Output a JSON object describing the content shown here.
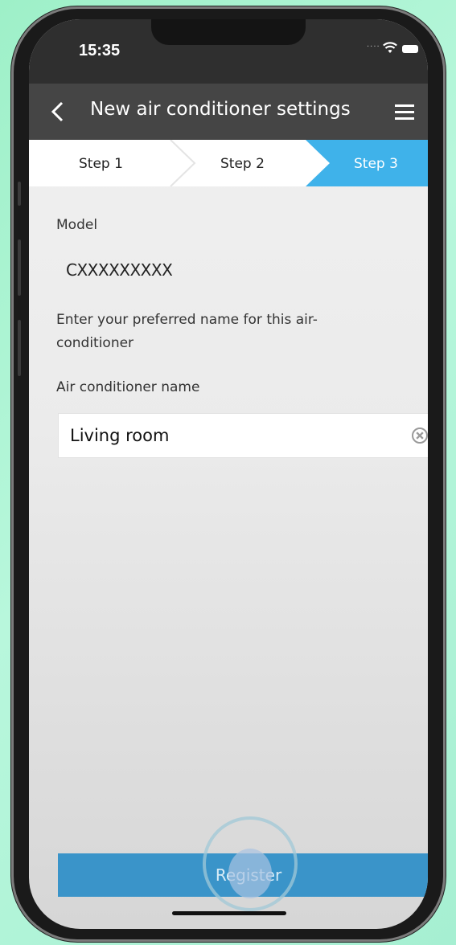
{
  "status_bar": {
    "time": "15:35",
    "signal_text": "....",
    "wifi_icon": "wifi-icon",
    "battery_icon": "battery-icon"
  },
  "header": {
    "title": "New air conditioner settings",
    "back_icon": "chevron-left-icon",
    "menu_icon": "hamburger-menu-icon"
  },
  "steps": [
    {
      "label": "Step 1",
      "active": false
    },
    {
      "label": "Step 2",
      "active": false
    },
    {
      "label": "Step 3",
      "active": true
    }
  ],
  "model": {
    "label": "Model",
    "value": "CXXXXXXXXX"
  },
  "instruction": "Enter your preferred name for this air-conditioner",
  "name_field": {
    "label": "Air conditioner name",
    "value": "Living room",
    "clear_icon": "clear-icon"
  },
  "register_button": {
    "label": "Register"
  },
  "colors": {
    "header_bg": "#454545",
    "status_bar_bg": "#2f2f2f",
    "step_active_bg": "#3fb2ea",
    "register_bg": "#3a94c9",
    "background": "#9ef0c8"
  }
}
